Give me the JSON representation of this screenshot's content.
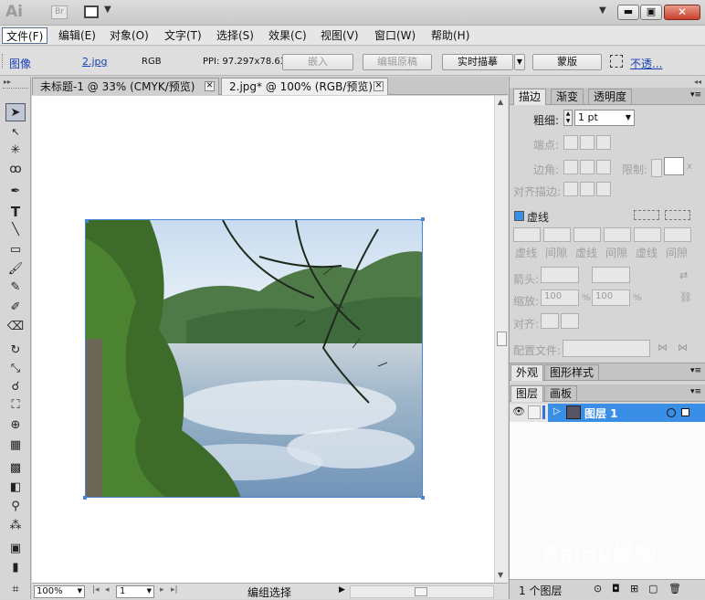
{
  "app": {
    "logo": "Ai",
    "bridge": "Br"
  },
  "menu": [
    "文件(F)",
    "编辑(E)",
    "对象(O)",
    "文字(T)",
    "选择(S)",
    "效果(C)",
    "视图(V)",
    "窗口(W)",
    "帮助(H)"
  ],
  "control": {
    "object_type": "图像",
    "filename": "2.jpg",
    "color_mode": "RGB",
    "ppi": "PPI: 97.297x78.63",
    "embed": "嵌入",
    "edit_original": "编辑原稿",
    "live_trace": "实时描摹",
    "mask": "蒙版",
    "opacity_link": "不透..."
  },
  "doc_tabs": [
    "未标题-1 @ 33% (CMYK/预览)",
    "2.jpg* @ 100% (RGB/预览)"
  ],
  "stroke_panel": {
    "tabs": [
      "描边",
      "渐变",
      "透明度"
    ],
    "weight_label": "粗细:",
    "weight_value": "1 pt",
    "cap_label": "端点:",
    "corner_label": "边角:",
    "limit_label": "限制:",
    "limit_suffix": "x",
    "align_label": "对齐描边:",
    "dashed_label": "虚线",
    "dash_labels": [
      "虚线",
      "间隙",
      "虚线",
      "间隙",
      "虚线",
      "间隙"
    ],
    "arrow_label": "箭头:",
    "scale_label": "缩放:",
    "scale_value_1": "100",
    "scale_value_2": "100",
    "percent": "%",
    "align2_label": "对齐:",
    "profile_label": "配置文件:"
  },
  "appearance_panel": {
    "tabs": [
      "外观",
      "图形样式"
    ]
  },
  "layers_panel": {
    "tabs": [
      "图层",
      "画板"
    ],
    "layer_name": "图层 1",
    "status": "1 个图层"
  },
  "status": {
    "zoom": "100%",
    "page": "1",
    "tool": "编组选择"
  },
  "watermark": {
    "text": "Baidu经验",
    "url": "jingyan.baidu.com"
  },
  "colors": {
    "accent": "#3a8ee6",
    "selection": "#4a86d8"
  }
}
